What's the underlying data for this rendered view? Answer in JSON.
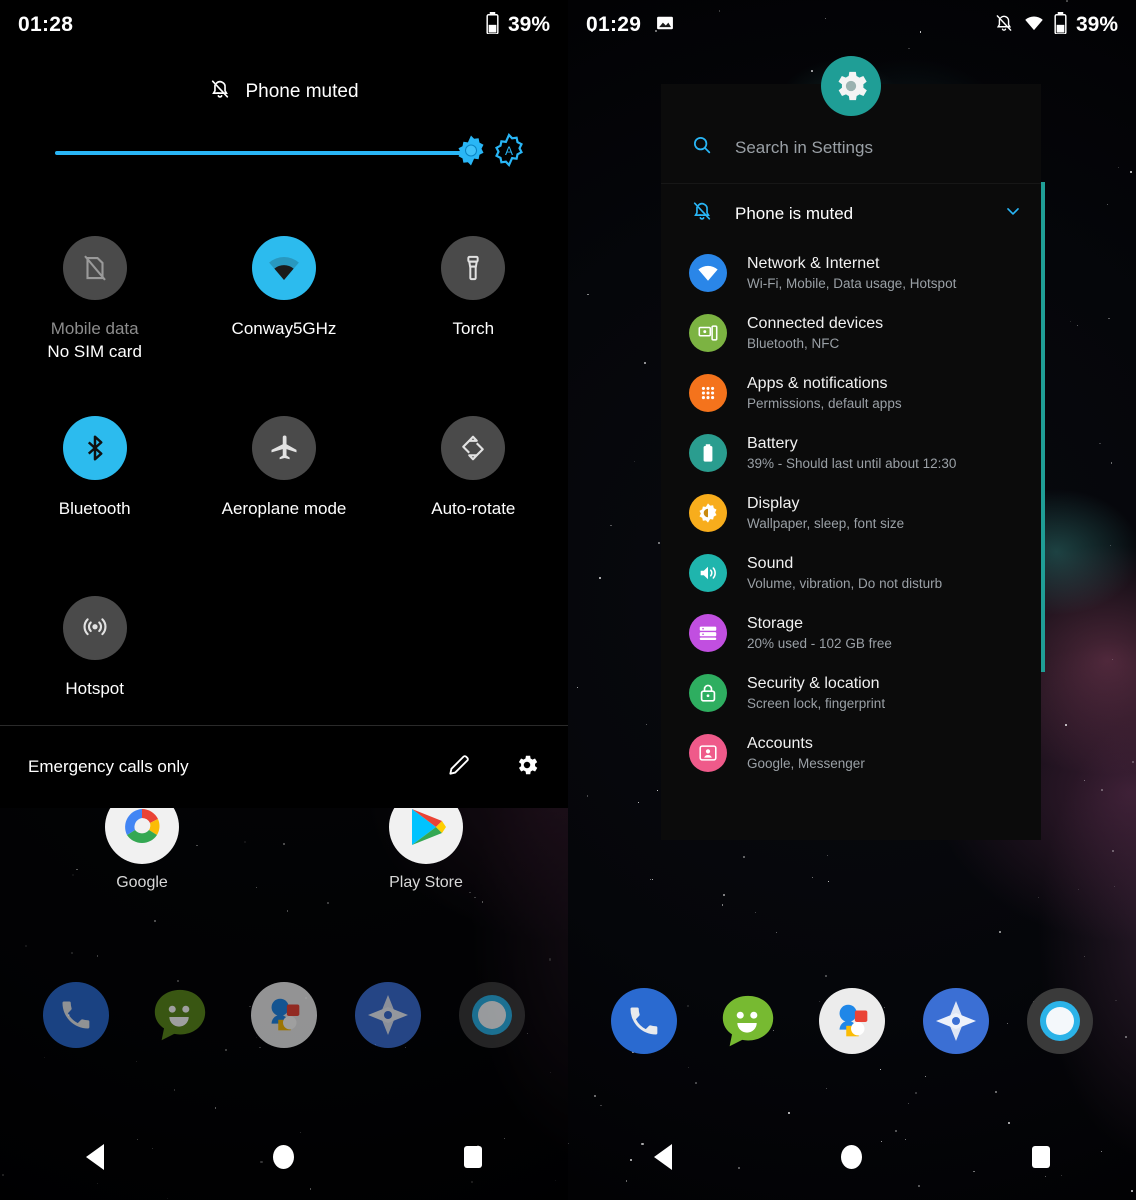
{
  "left_screen": {
    "status_bar": {
      "time": "01:28",
      "battery_percent": "39%",
      "battery_icon": "battery-icon"
    },
    "quick_settings": {
      "muted_notice": "Phone muted",
      "muted_icon": "bell-slash-icon",
      "brightness": {
        "icon": "brightness-thumb-icon",
        "auto_icon": "auto-brightness-icon",
        "value_percent": 100
      },
      "tiles": [
        {
          "label": "Mobile data",
          "sublabel": "No SIM card",
          "icon": "sim-card-off-icon",
          "state": "off",
          "label_dim": true
        },
        {
          "label": "Conway5GHz",
          "sublabel": "",
          "icon": "wifi-icon",
          "state": "on",
          "label_dim": false
        },
        {
          "label": "Torch",
          "sublabel": "",
          "icon": "flashlight-icon",
          "state": "off",
          "label_dim": false
        },
        {
          "label": "Bluetooth",
          "sublabel": "",
          "icon": "bluetooth-icon",
          "state": "on",
          "label_dim": false
        },
        {
          "label": "Aeroplane mode",
          "sublabel": "",
          "icon": "airplane-icon",
          "state": "off",
          "label_dim": false
        },
        {
          "label": "Auto-rotate",
          "sublabel": "",
          "icon": "auto-rotate-icon",
          "state": "off",
          "label_dim": false
        },
        {
          "label": "Hotspot",
          "sublabel": "",
          "icon": "hotspot-icon",
          "state": "off",
          "label_dim": false
        }
      ],
      "footer": {
        "carrier_text": "Emergency calls only",
        "edit_icon": "pencil-icon",
        "settings_icon": "gear-icon"
      }
    },
    "home_apps": [
      {
        "label": "Google",
        "icon": "google-icon"
      },
      {
        "label": "Play Store",
        "icon": "play-store-icon"
      }
    ],
    "dock": [
      {
        "icon": "phone-icon"
      },
      {
        "icon": "messages-icon"
      },
      {
        "icon": "contacts-icon"
      },
      {
        "icon": "navigation-icon"
      },
      {
        "icon": "camera-icon"
      }
    ],
    "nav_bar": {
      "back": "back-icon",
      "home": "home-icon",
      "recents": "recents-icon"
    }
  },
  "right_screen": {
    "status_bar": {
      "time": "01:29",
      "screenshot_icon": "image-icon",
      "mute_icon": "bell-slash-icon",
      "wifi_icon": "wifi-icon",
      "battery_icon": "battery-icon",
      "battery_percent": "39%"
    },
    "settings_panel": {
      "gear_icon": "settings-gear-icon",
      "search": {
        "icon": "search-icon",
        "placeholder": "Search in Settings"
      },
      "muted_row": {
        "icon": "bell-slash-icon",
        "label": "Phone is muted",
        "chevron": "chevron-down-icon"
      },
      "items": [
        {
          "title": "Network & Internet",
          "subtitle": "Wi-Fi, Mobile, Data usage, Hotspot",
          "icon": "wifi-icon",
          "color": "#2a86e8"
        },
        {
          "title": "Connected devices",
          "subtitle": "Bluetooth, NFC",
          "icon": "connected-devices-icon",
          "color": "#7cb342"
        },
        {
          "title": "Apps & notifications",
          "subtitle": "Permissions, default apps",
          "icon": "apps-grid-icon",
          "color": "#f4731c"
        },
        {
          "title": "Battery",
          "subtitle": "39% - Should last until about 12:30",
          "icon": "battery-icon",
          "color": "#2a9d8f"
        },
        {
          "title": "Display",
          "subtitle": "Wallpaper, sleep, font size",
          "icon": "brightness-icon",
          "color": "#f8ad1c"
        },
        {
          "title": "Sound",
          "subtitle": "Volume, vibration, Do not disturb",
          "icon": "speaker-icon",
          "color": "#1fb5ad"
        },
        {
          "title": "Storage",
          "subtitle": "20% used - 102 GB free",
          "icon": "storage-icon",
          "color": "#c14fe0"
        },
        {
          "title": "Security & location",
          "subtitle": "Screen lock, fingerprint",
          "icon": "lock-icon",
          "color": "#2eae60"
        },
        {
          "title": "Accounts",
          "subtitle": "Google, Messenger",
          "icon": "account-icon",
          "color": "#ef5a8a"
        }
      ],
      "scrollbar_color": "#1f9e96"
    },
    "dock": [
      {
        "icon": "phone-icon"
      },
      {
        "icon": "messages-icon"
      },
      {
        "icon": "contacts-icon"
      },
      {
        "icon": "navigation-icon"
      },
      {
        "icon": "camera-icon"
      }
    ],
    "nav_bar": {
      "back": "back-icon",
      "home": "home-icon",
      "recents": "recents-icon"
    }
  },
  "theme": {
    "accent_blue": "#2cbbee",
    "accent_teal": "#1f9e96",
    "panel_bg": "#0b0b0b",
    "text_primary": "#ffffff",
    "text_secondary": "#9aa0a6"
  }
}
